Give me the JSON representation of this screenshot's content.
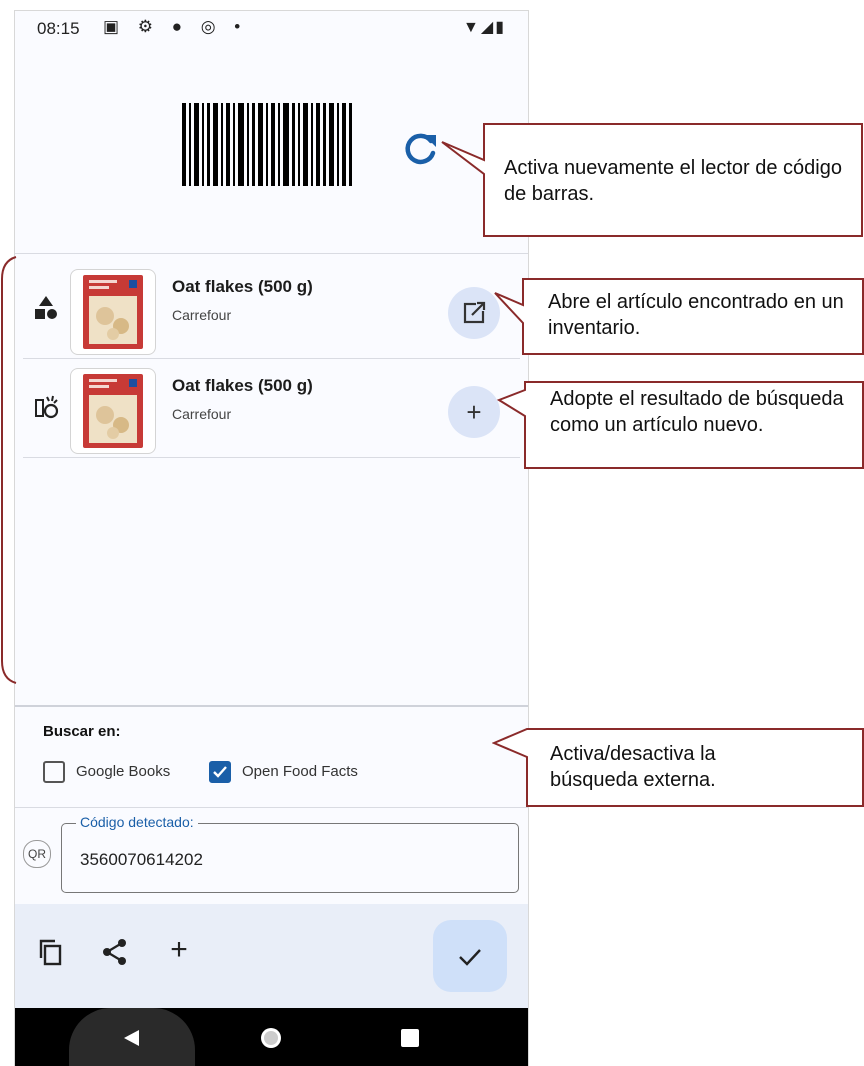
{
  "status_bar": {
    "time": "08:15",
    "icons": "▣ ⚙ ● ◎ •",
    "right": "▼◢▮"
  },
  "results": [
    {
      "title": "Oat flakes (500 g)",
      "brand": "Carrefour",
      "kind_icon": "shapes-icon",
      "action_icon": "open-external-icon"
    },
    {
      "title": "Oat flakes (500 g)",
      "brand": "Carrefour",
      "kind_icon": "adopt-icon",
      "action_icon": "plus-icon",
      "action_text": "+"
    }
  ],
  "search": {
    "label": "Buscar en:",
    "sources": [
      {
        "label": "Google Books",
        "checked": false
      },
      {
        "label": "Open Food Facts",
        "checked": true
      }
    ]
  },
  "code": {
    "prefix": "QR",
    "legend": "Código detectado:",
    "value": "3560070614202"
  },
  "bottom": {
    "add_text": "+"
  },
  "callouts": {
    "rescan": "Activa nuevamente el lector de código de barras.",
    "open": "Abre el artículo encontrado en un inventario.",
    "adopt": "Adopte el resultado de búsqueda como un artículo nuevo.",
    "toggle": "Activa/desactiva la búsqueda externa."
  },
  "colors": {
    "accent": "#1a5fa8",
    "callout_border": "#8a2a2a",
    "action_bg": "#dbe4f7"
  }
}
